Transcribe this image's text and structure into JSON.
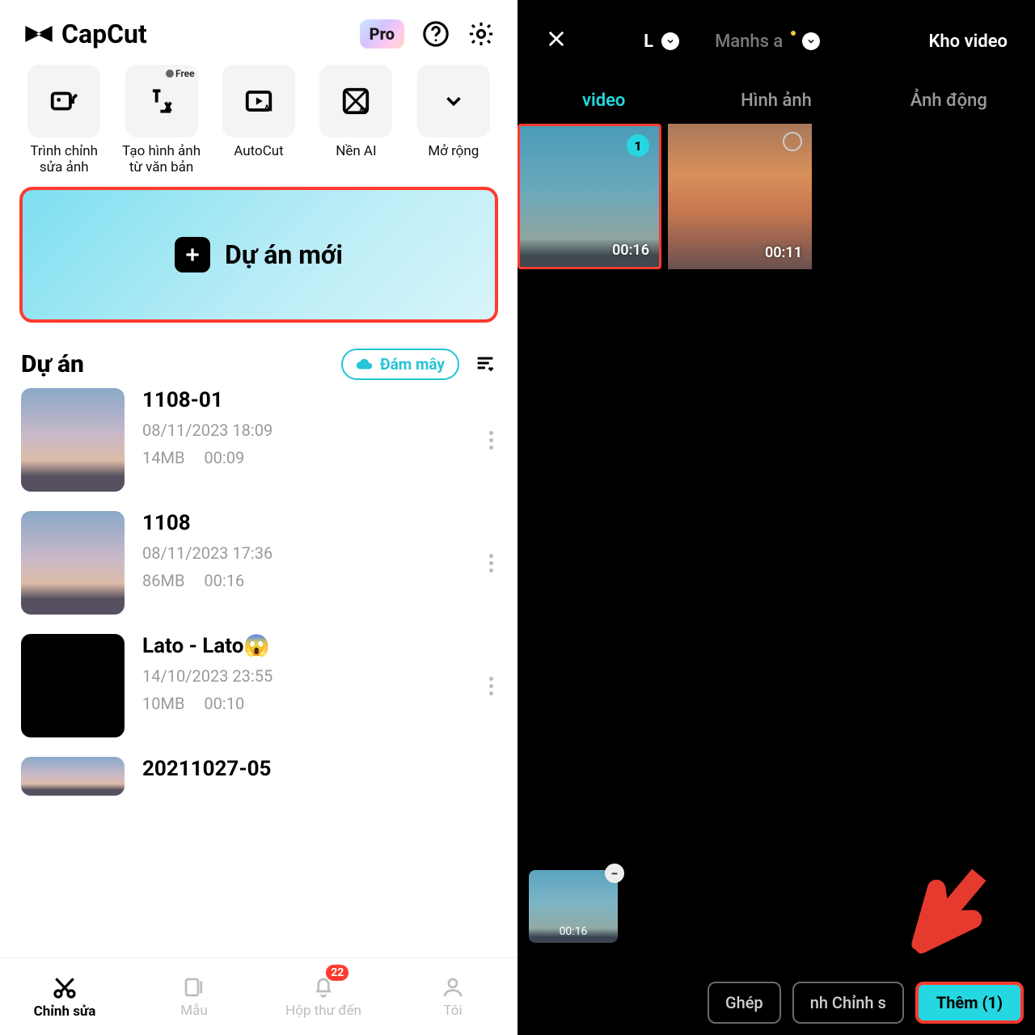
{
  "left": {
    "brand": "CapCut",
    "pro_label": "Pro",
    "tools": [
      {
        "label": "Trình chỉnh sửa ảnh"
      },
      {
        "label": "Tạo hình ảnh từ văn bản",
        "free": "Free"
      },
      {
        "label": "AutoCut"
      },
      {
        "label": "Nền AI"
      },
      {
        "label": "Mở rộng"
      }
    ],
    "new_project_label": "Dự án mới",
    "projects_title": "Dự án",
    "cloud_label": "Đám mây",
    "projects": [
      {
        "name": "1108-01",
        "date": "08/11/2023 18:09",
        "size": "14MB",
        "duration": "00:09",
        "thumb": "sky1"
      },
      {
        "name": "1108",
        "date": "08/11/2023 17:36",
        "size": "86MB",
        "duration": "00:16",
        "thumb": "sky1"
      },
      {
        "name": "Lato - Lato😱",
        "date": "14/10/2023 23:55",
        "size": "10MB",
        "duration": "00:10",
        "thumb": "dark-thumb"
      },
      {
        "name": "20211027-05",
        "date": "",
        "size": "",
        "duration": "",
        "thumb": "sky1"
      }
    ],
    "nav": {
      "edit": "Chỉnh sửa",
      "templates": "Mẫu",
      "inbox": "Hộp thư đến",
      "inbox_badge": "22",
      "me": "Tôi"
    }
  },
  "right": {
    "album1": "L",
    "album2": "Manhs a",
    "video_store": "Kho video",
    "tabs": {
      "video": "video",
      "image": "Hình ảnh",
      "gif": "Ảnh động"
    },
    "media": [
      {
        "duration": "00:16",
        "selected_index": "1",
        "thumb": "sky2"
      },
      {
        "duration": "00:11",
        "thumb": "sky4"
      }
    ],
    "tray": {
      "duration": "00:16"
    },
    "actions": {
      "merge": "Ghép",
      "edit_partial": "nh   Chỉnh s",
      "add": "Thêm (1)"
    }
  }
}
